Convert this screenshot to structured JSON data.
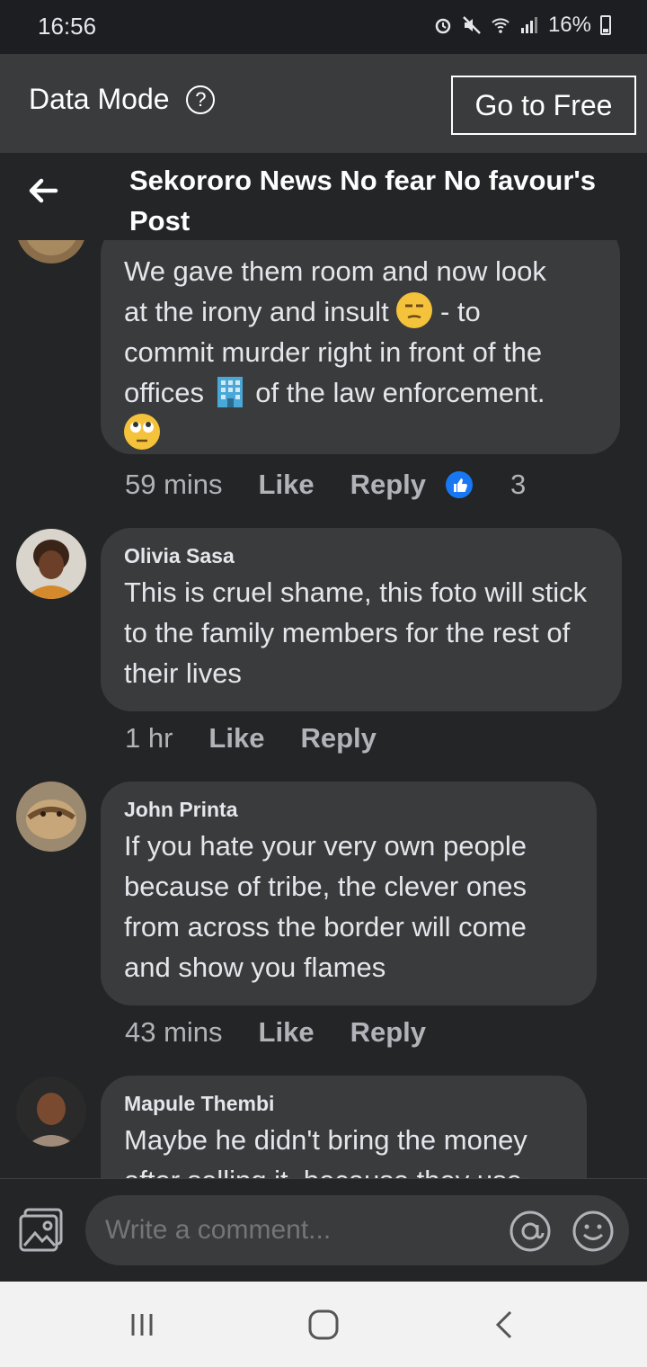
{
  "status_bar": {
    "time": "16:56",
    "battery": "16%"
  },
  "data_mode": {
    "label": "Data Mode",
    "help": "?",
    "button": "Go to Free"
  },
  "header": {
    "title": "Sekororo News No fear No favour's Post"
  },
  "comments": [
    {
      "author": "",
      "lines": [
        "We gave them room and now look",
        "at the irony and insult",
        "- to",
        "commit murder right in front of the",
        "offices",
        "of the law enforcement."
      ],
      "time": "59 mins",
      "like": "Like",
      "reply": "Reply",
      "reactions": "3"
    },
    {
      "author": "Olivia Sasa",
      "text": "This is cruel shame, this foto will stick to the family members for the rest of their lives",
      "time": "1 hr",
      "like": "Like",
      "reply": "Reply"
    },
    {
      "author": "John Printa",
      "text": "If you hate your very own people because of tribe, the clever ones from across the border will come and show you flames",
      "time": "43 mins",
      "like": "Like",
      "reply": "Reply"
    },
    {
      "author": "Mapule Thembi",
      "text": "Maybe he didn't bring the money after selling it, because they use",
      "time": "",
      "like": "",
      "reply": ""
    }
  ],
  "composer": {
    "placeholder": "Write a comment..."
  },
  "icons": {
    "back": "arrow-left-icon",
    "photo": "photo-icon",
    "mention": "at-icon",
    "emoji": "smile-icon",
    "nav_recents": "recents-icon",
    "nav_home": "home-icon",
    "nav_back": "back-chevron-icon"
  },
  "colors": {
    "background": "#242526",
    "bubble": "#3a3b3c",
    "like_blue": "#1877f2"
  }
}
